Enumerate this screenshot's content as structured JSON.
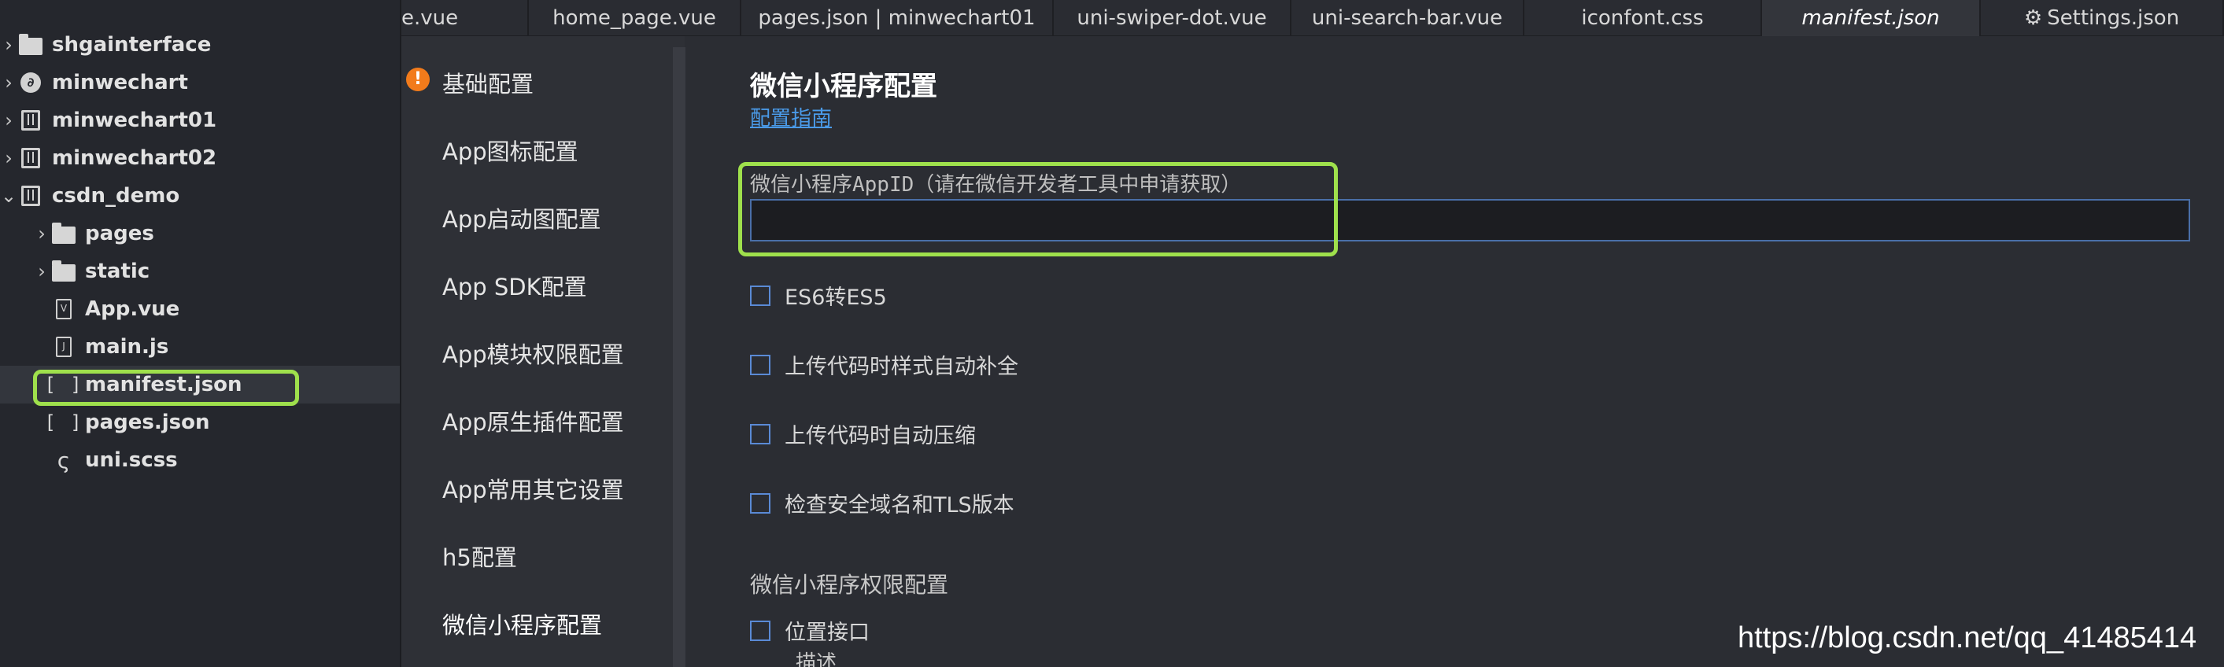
{
  "tree": {
    "items": [
      {
        "label": "shgainterface",
        "chevron": "›",
        "icon": "folder-icon"
      },
      {
        "label": "minwechart",
        "chevron": "›",
        "icon": "gear-round-icon"
      },
      {
        "label": "minwechart01",
        "chevron": "›",
        "icon": "project-icon"
      },
      {
        "label": "minwechart02",
        "chevron": "›",
        "icon": "project-icon"
      },
      {
        "label": "csdn_demo",
        "chevron": "⌄",
        "icon": "project-icon"
      },
      {
        "label": "pages",
        "chevron": "›",
        "icon": "folder-icon"
      },
      {
        "label": "static",
        "chevron": "›",
        "icon": "folder-icon"
      },
      {
        "label": "App.vue",
        "icon": "vue-file-icon",
        "glyph": "V"
      },
      {
        "label": "main.js",
        "icon": "js-file-icon",
        "glyph": "J"
      },
      {
        "label": "manifest.json",
        "icon": "json-bracket-icon",
        "glyph": "[ ]"
      },
      {
        "label": "pages.json",
        "icon": "json-bracket-icon",
        "glyph": "[ ]"
      },
      {
        "label": "uni.scss",
        "icon": "scss-icon",
        "glyph": "ς"
      }
    ]
  },
  "tabs": [
    {
      "label": "e.vue"
    },
    {
      "label": "home_page.vue"
    },
    {
      "label": "pages.json | minwechart01"
    },
    {
      "label": "uni-swiper-dot.vue"
    },
    {
      "label": "uni-search-bar.vue"
    },
    {
      "label": "iconfont.css"
    },
    {
      "label": "manifest.json"
    },
    {
      "label": "Settings.json",
      "icon": "⚙"
    }
  ],
  "nav": {
    "warn_glyph": "!",
    "items": [
      {
        "label": "基础配置"
      },
      {
        "label": "App图标配置"
      },
      {
        "label": "App启动图配置"
      },
      {
        "label": "App  SDK配置"
      },
      {
        "label": "App模块权限配置"
      },
      {
        "label": "App原生插件配置"
      },
      {
        "label": "App常用其它设置"
      },
      {
        "label": "h5配置"
      },
      {
        "label": "微信小程序配置"
      }
    ]
  },
  "main": {
    "title": "微信小程序配置",
    "guide_link": "配置指南",
    "appid_label": "微信小程序AppID（请在微信开发者工具中申请获取）",
    "appid_value": "",
    "checkboxes": [
      {
        "label": "ES6转ES5"
      },
      {
        "label": "上传代码时样式自动补全"
      },
      {
        "label": "上传代码时自动压缩"
      },
      {
        "label": "检查安全域名和TLS版本"
      }
    ],
    "permission_title": "微信小程序权限配置",
    "location_checkbox": "位置接口",
    "description": "描述"
  },
  "watermark": "https://blog.csdn.net/qq_41485414",
  "colors": {
    "highlight": "#9fe04c",
    "link": "#4a9ae8",
    "warning": "#f27b1b",
    "checkbox": "#5a8ad6"
  }
}
